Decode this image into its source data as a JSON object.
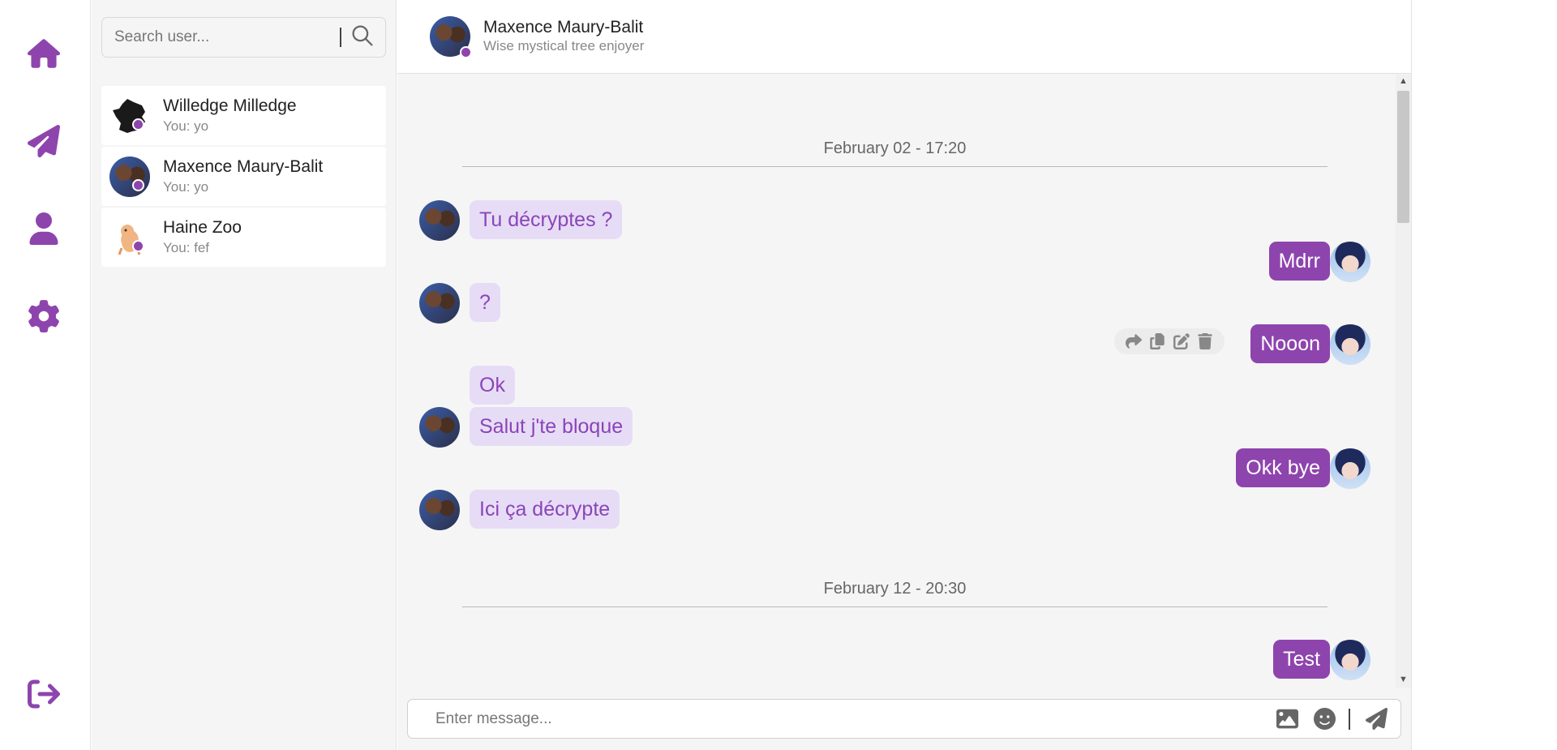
{
  "theme": {
    "accent": "#8e44ad",
    "bubble_in_bg": "#e7dcf6",
    "bubble_in_text": "#8a45b8"
  },
  "nav": {
    "items": [
      {
        "icon": "home-icon"
      },
      {
        "icon": "paper-plane-icon"
      },
      {
        "icon": "user-icon"
      },
      {
        "icon": "gear-icon"
      }
    ],
    "logout_icon": "logout-icon"
  },
  "search": {
    "placeholder": "Search user...",
    "icon": "search-icon"
  },
  "contacts": [
    {
      "name": "Willedge Milledge",
      "last_message": "You: yo",
      "online": true
    },
    {
      "name": "Maxence Maury-Balit",
      "last_message": "You: yo",
      "online": true
    },
    {
      "name": "Haine Zoo",
      "last_message": "You: fef",
      "online": true
    }
  ],
  "chat": {
    "title": "Maxence Maury-Balit",
    "subtitle": "Wise mystical tree enjoyer",
    "dates": [
      "February 02 - 17:20",
      "February 12 - 20:30"
    ],
    "messages": [
      {
        "text": "Tu décryptes ?",
        "direction": "in"
      },
      {
        "text": "Mdrr",
        "direction": "out"
      },
      {
        "text": "?",
        "direction": "in"
      },
      {
        "text": "Nooon",
        "direction": "out"
      },
      {
        "text": "Ok",
        "direction": "in"
      },
      {
        "text": "Salut j'te bloque",
        "direction": "in"
      },
      {
        "text": "Okk bye",
        "direction": "out"
      },
      {
        "text": "Ici ça décrypte",
        "direction": "in"
      },
      {
        "text": "Test",
        "direction": "out"
      }
    ],
    "message_actions": [
      "forward-icon",
      "copy-icon",
      "edit-icon",
      "trash-icon"
    ]
  },
  "composer": {
    "placeholder": "Enter message...",
    "icons": [
      "image-icon",
      "emoji-icon",
      "send-icon"
    ]
  }
}
